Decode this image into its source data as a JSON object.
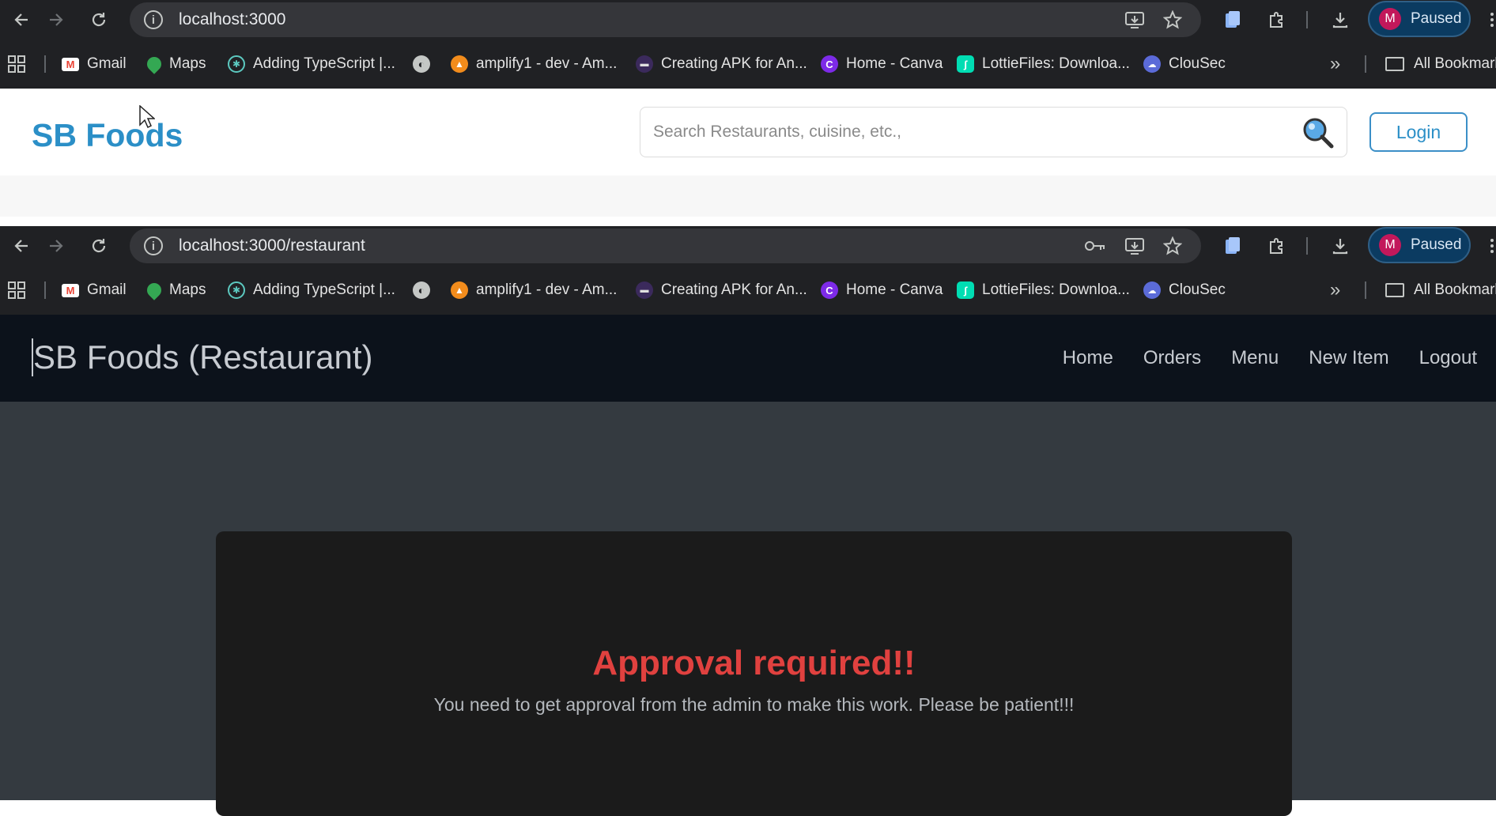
{
  "window1": {
    "url": "localhost:3000",
    "profile": {
      "initial": "M",
      "status": "Paused"
    }
  },
  "window2": {
    "url": "localhost:3000/restaurant",
    "profile": {
      "initial": "M",
      "status": "Paused"
    }
  },
  "bookmarks": {
    "items": [
      {
        "label": "Gmail",
        "icon": "gmail-icon"
      },
      {
        "label": "Maps",
        "icon": "maps-icon"
      },
      {
        "label": "Adding TypeScript |...",
        "icon": "react-icon"
      },
      {
        "label": "",
        "icon": "globe-icon"
      },
      {
        "label": "amplify1 - dev - Am...",
        "icon": "amplify-icon"
      },
      {
        "label": "Creating APK for An...",
        "icon": "expo-icon"
      },
      {
        "label": "Home - Canva",
        "icon": "canva-icon"
      },
      {
        "label": "LottieFiles: Downloa...",
        "icon": "lottie-icon"
      },
      {
        "label": "ClouSec",
        "icon": "clousec-icon"
      }
    ],
    "all_bookmarks": "All Bookmarks"
  },
  "page1": {
    "brand": "SB Foods",
    "search_placeholder": "Search Restaurants, cuisine, etc.,",
    "login_label": "Login",
    "brand_color": "#2b8fc7"
  },
  "page2": {
    "brand": "SB Foods (Restaurant)",
    "nav": [
      "Home",
      "Orders",
      "Menu",
      "New Item",
      "Logout"
    ],
    "title": "Approval required!!",
    "message": "You need to get approval from the admin to make this work. Please be patient!!!",
    "title_color": "#e0413f"
  }
}
